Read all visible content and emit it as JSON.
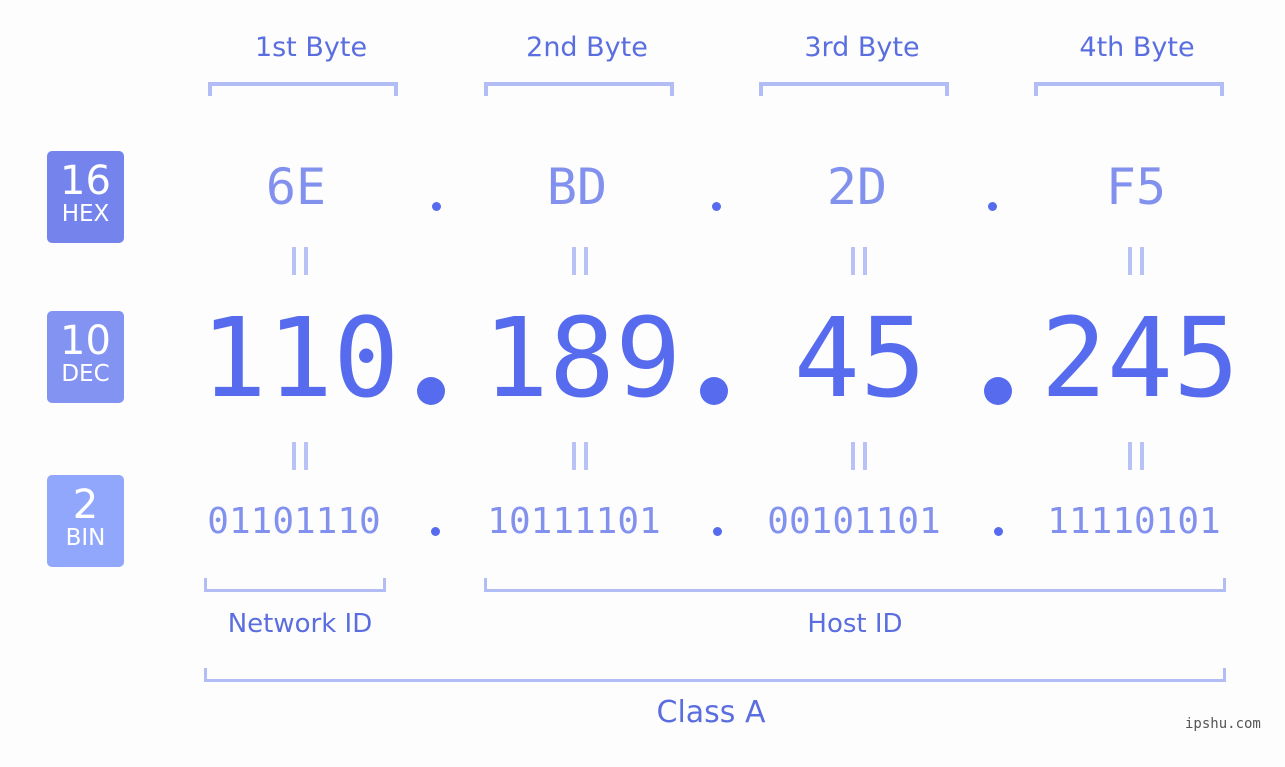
{
  "byte_headers": [
    "1st Byte",
    "2nd Byte",
    "3rd Byte",
    "4th Byte"
  ],
  "badges": [
    {
      "number": "16",
      "label": "HEX",
      "color": "#7584ec"
    },
    {
      "number": "10",
      "label": "DEC",
      "color": "#8393f2"
    },
    {
      "number": "2",
      "label": "BIN",
      "color": "#91a7fb"
    }
  ],
  "hex": [
    "6E",
    "BD",
    "2D",
    "F5"
  ],
  "dec": [
    "110",
    "189",
    "45",
    "245"
  ],
  "bin": [
    "01101110",
    "10111101",
    "00101101",
    "11110101"
  ],
  "separator": ".",
  "segments": {
    "network": "Network ID",
    "host": "Host ID",
    "class": "Class A"
  },
  "watermark": "ipshu.com",
  "colors": {
    "accent": "#566bed",
    "hex_text": "#8391ee",
    "bracket": "#b2bdf6",
    "background": "#fcfdfc"
  }
}
